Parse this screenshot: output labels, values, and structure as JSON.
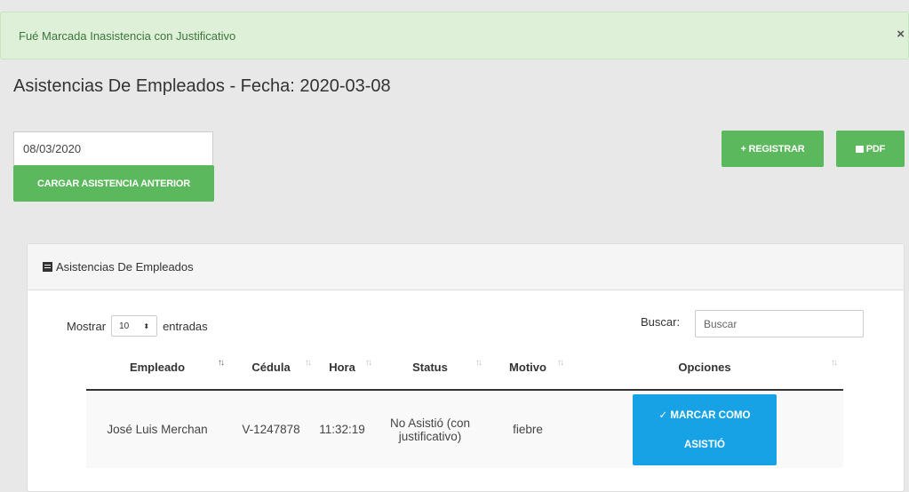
{
  "alert": {
    "message": "Fué Marcada Inasistencia con Justificativo",
    "close": "×"
  },
  "page": {
    "title": "Asistencias De Empleados - Fecha: 2020-03-08"
  },
  "date_input": {
    "value": "08/03/2020"
  },
  "buttons": {
    "load_previous": "CARGAR ASISTENCIA ANTERIOR",
    "register": "+ REGISTRAR",
    "pdf": "PDF"
  },
  "panel": {
    "title": "Asistencias De Empleados",
    "show_label": "Mostrar",
    "entries_value": "10",
    "entries_label": "entradas",
    "search_label": "Buscar:",
    "search_placeholder": "Buscar"
  },
  "table": {
    "columns": [
      "Empleado",
      "Cédula",
      "Hora",
      "Status",
      "Motivo",
      "Opciones"
    ],
    "rows": [
      {
        "employee": "José Luis Merchan",
        "id": "V-1247878",
        "time": "11:32:19",
        "status_line1": "No Asistió (con",
        "status_line2": "justificativo)",
        "reason": "fiebre",
        "action_line1": "✓ MARCAR COMO",
        "action_line2": "ASISTIÓ"
      }
    ]
  },
  "colors": {
    "success": "#5cb85c",
    "primary": "#17a2e6",
    "alert_bg": "#dff0d8"
  }
}
